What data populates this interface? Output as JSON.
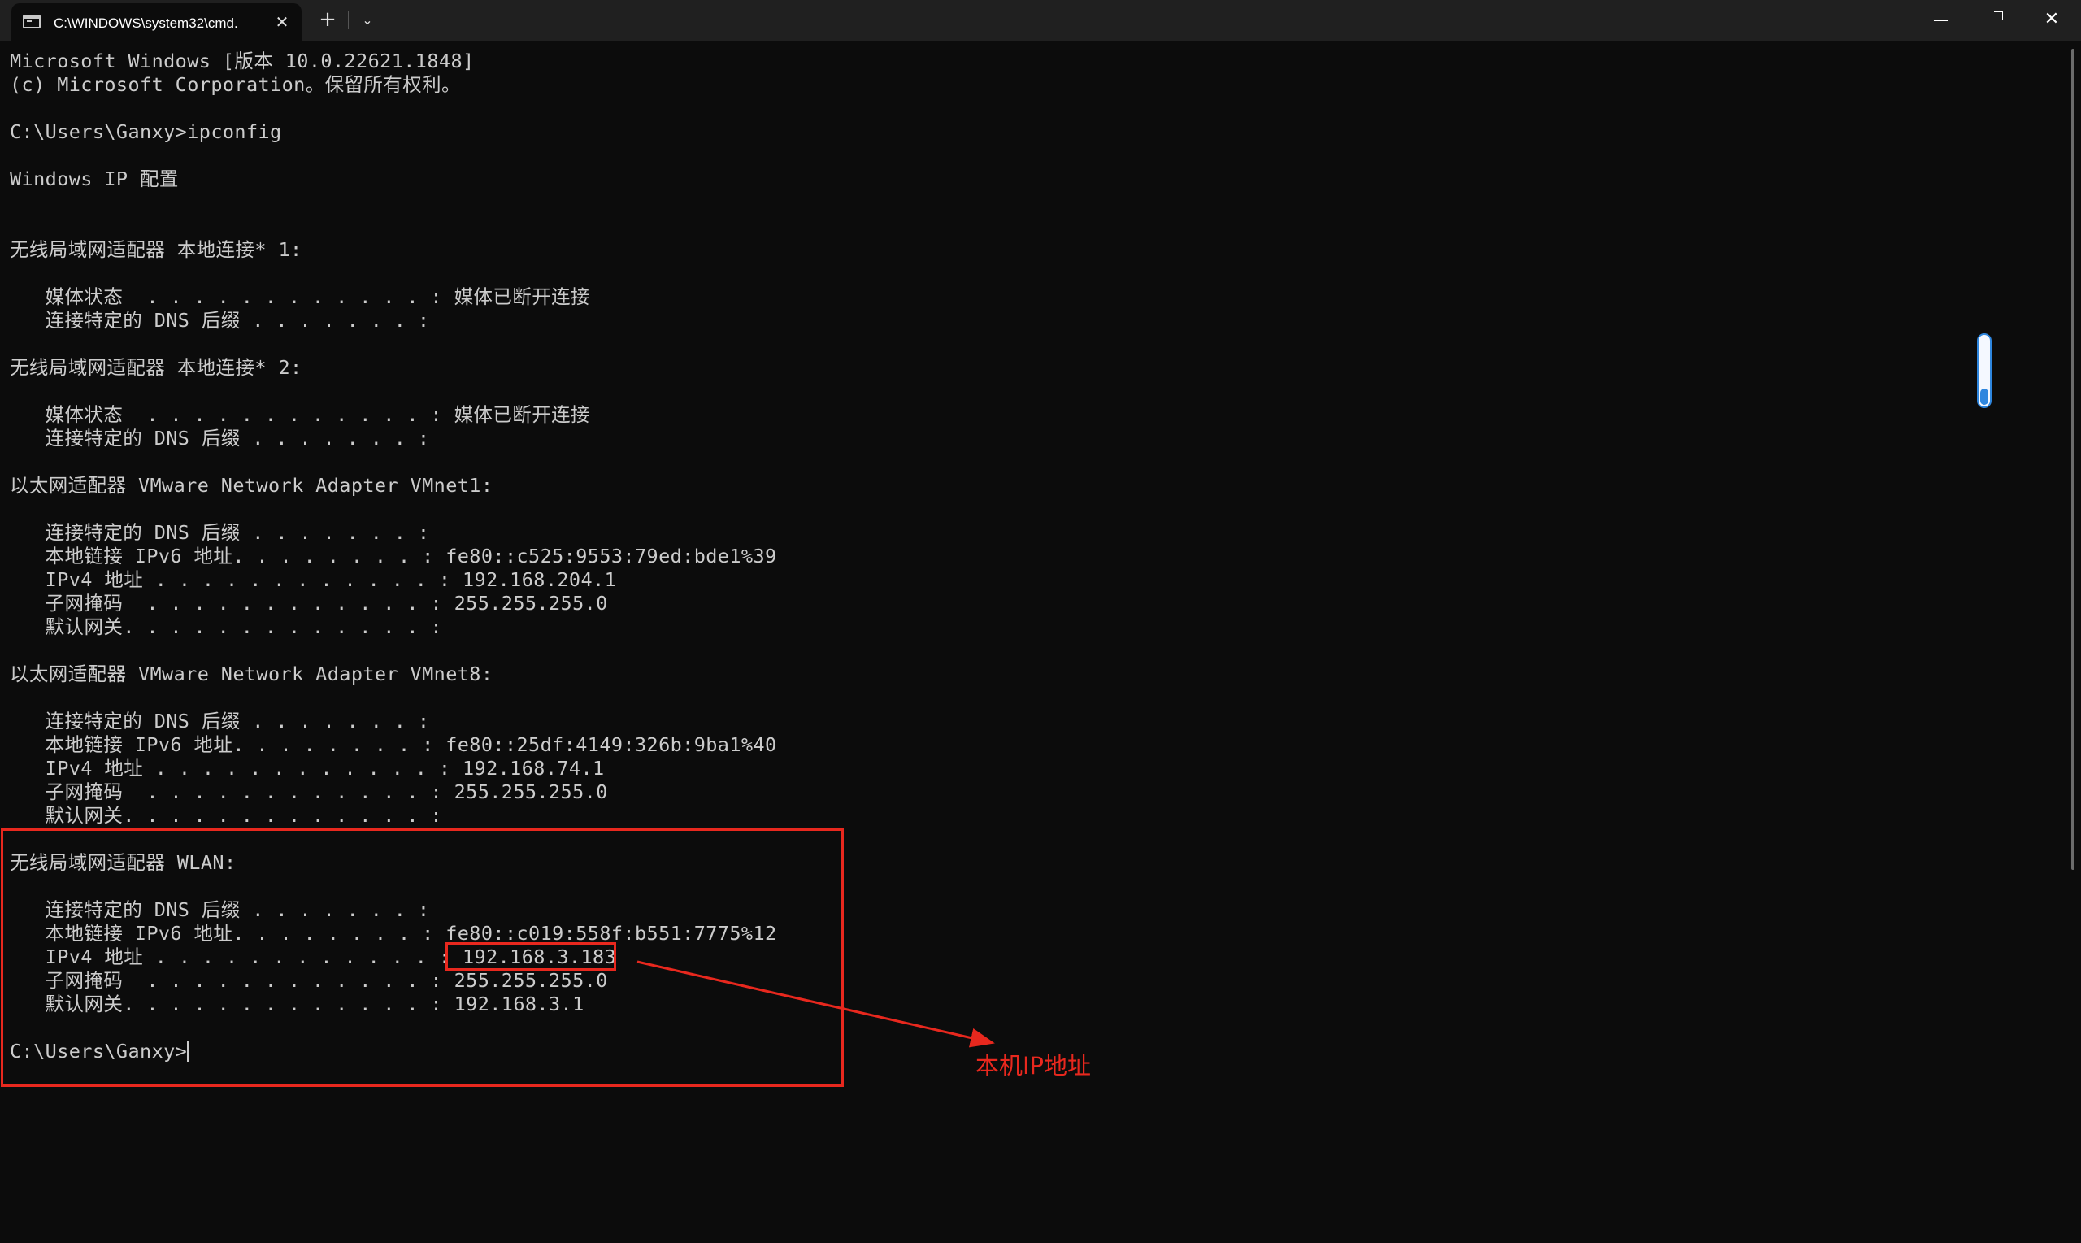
{
  "window": {
    "tab_title": "C:\\WINDOWS\\system32\\cmd.",
    "tab_close": "✕",
    "new_tab": "+",
    "dropdown": "⌄",
    "minimize": "—",
    "close": "✕"
  },
  "terminal": {
    "lines": [
      "Microsoft Windows [版本 10.0.22621.1848]",
      "(c) Microsoft Corporation。保留所有权利。",
      "",
      "C:\\Users\\Ganxy>ipconfig",
      "",
      "Windows IP 配置",
      "",
      "",
      "无线局域网适配器 本地连接* 1:",
      "",
      "   媒体状态  . . . . . . . . . . . . : 媒体已断开连接",
      "   连接特定的 DNS 后缀 . . . . . . . :",
      "",
      "无线局域网适配器 本地连接* 2:",
      "",
      "   媒体状态  . . . . . . . . . . . . : 媒体已断开连接",
      "   连接特定的 DNS 后缀 . . . . . . . :",
      "",
      "以太网适配器 VMware Network Adapter VMnet1:",
      "",
      "   连接特定的 DNS 后缀 . . . . . . . :",
      "   本地链接 IPv6 地址. . . . . . . . : fe80::c525:9553:79ed:bde1%39",
      "   IPv4 地址 . . . . . . . . . . . . : 192.168.204.1",
      "   子网掩码  . . . . . . . . . . . . : 255.255.255.0",
      "   默认网关. . . . . . . . . . . . . :",
      "",
      "以太网适配器 VMware Network Adapter VMnet8:",
      "",
      "   连接特定的 DNS 后缀 . . . . . . . :",
      "   本地链接 IPv6 地址. . . . . . . . : fe80::25df:4149:326b:9ba1%40",
      "   IPv4 地址 . . . . . . . . . . . . : 192.168.74.1",
      "   子网掩码  . . . . . . . . . . . . : 255.255.255.0",
      "   默认网关. . . . . . . . . . . . . :",
      "",
      "无线局域网适配器 WLAN:",
      "",
      "   连接特定的 DNS 后缀 . . . . . . . :",
      "   本地链接 IPv6 地址. . . . . . . . : fe80::c019:558f:b551:7775%12",
      "   IPv4 地址 . . . . . . . . . . . . : 192.168.3.183",
      "   子网掩码  . . . . . . . . . . . . : 255.255.255.0",
      "   默认网关. . . . . . . . . . . . . : 192.168.3.1",
      ""
    ],
    "prompt": "C:\\Users\\Ganxy>"
  },
  "annotation": {
    "label": "本机IP地址",
    "color": "#e8281e"
  },
  "colors": {
    "background": "#0c0c0c",
    "titlebar": "#202020",
    "text": "#cccccc",
    "scroll_accent": "#2e86de"
  }
}
